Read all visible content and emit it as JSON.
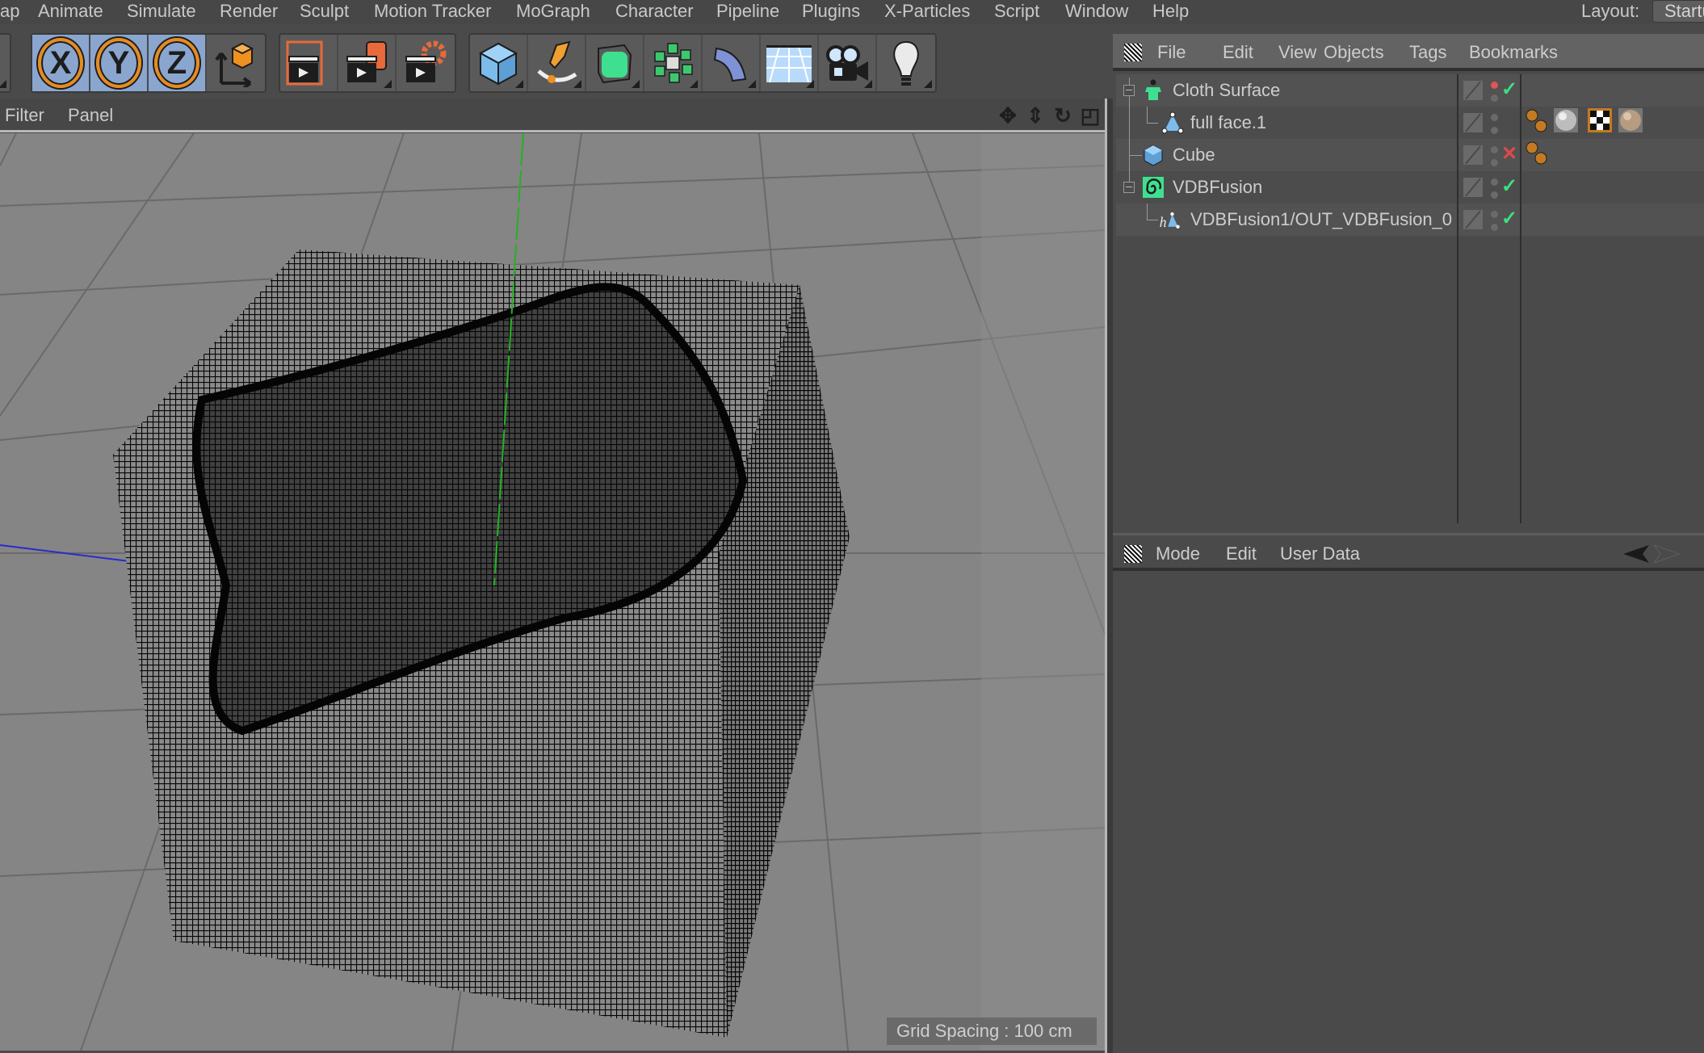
{
  "menubar": {
    "items": [
      "ap",
      "Animate",
      "Simulate",
      "Render",
      "Sculpt",
      "Motion Tracker",
      "MoGraph",
      "Character",
      "Pipeline",
      "Plugins",
      "X-Particles",
      "Script",
      "Window",
      "Help"
    ],
    "layout_label": "Layout:",
    "layout_value": "Startu"
  },
  "toolbar": {
    "axis_x": "X",
    "axis_y": "Y",
    "axis_z": "Z",
    "icons": [
      "lock-x-axis",
      "lock-y-axis",
      "lock-z-axis",
      "coordinate-system",
      "render-view",
      "render-to-picture-viewer",
      "render-settings",
      "cube",
      "pen-spline",
      "subdivision-surface",
      "cloner",
      "bend-deformer",
      "floor",
      "camera",
      "light"
    ]
  },
  "viewport": {
    "menu": [
      "Filter",
      "Panel"
    ],
    "nav_icons": [
      "move-view",
      "zoom-view",
      "rotate-view",
      "maximize-view"
    ],
    "grid_spacing": "Grid Spacing : 100 cm"
  },
  "object_manager": {
    "menu": [
      "File",
      "Edit",
      "View",
      "Objects",
      "Tags",
      "Bookmarks"
    ],
    "objects": [
      {
        "name": "Cloth Surface",
        "icon": "cloth-surface",
        "depth": 0,
        "collapsible": true,
        "editor_dot": "red",
        "status": "enabled",
        "tags": []
      },
      {
        "name": "full face.1",
        "icon": "polygon-object",
        "depth": 1,
        "collapsible": false,
        "editor_dot": "default",
        "status": "",
        "tags": [
          "phong",
          "material-grey",
          "material-checker",
          "material-skin"
        ]
      },
      {
        "name": "Cube",
        "icon": "cube",
        "depth": 0,
        "collapsible": false,
        "editor_dot": "default",
        "status": "disabled",
        "tags": [
          "phong"
        ]
      },
      {
        "name": "VDBFusion",
        "icon": "vdb-fusion",
        "depth": 0,
        "collapsible": true,
        "editor_dot": "default",
        "status": "enabled",
        "tags": []
      },
      {
        "name": "VDBFusion1/OUT_VDBFusion_0",
        "icon": "houdini-polygon",
        "depth": 1,
        "collapsible": false,
        "editor_dot": "default",
        "status": "enabled",
        "tags": []
      }
    ]
  },
  "attribute_manager": {
    "menu": [
      "Mode",
      "Edit",
      "User Data"
    ]
  },
  "colors": {
    "accent_active": "#8aa6cf",
    "axis_ring": "#e88b1e",
    "ok": "#3fe07c",
    "off": "#e04848",
    "y_axis": "#22b322",
    "x_axis": "#2a2ad0"
  }
}
